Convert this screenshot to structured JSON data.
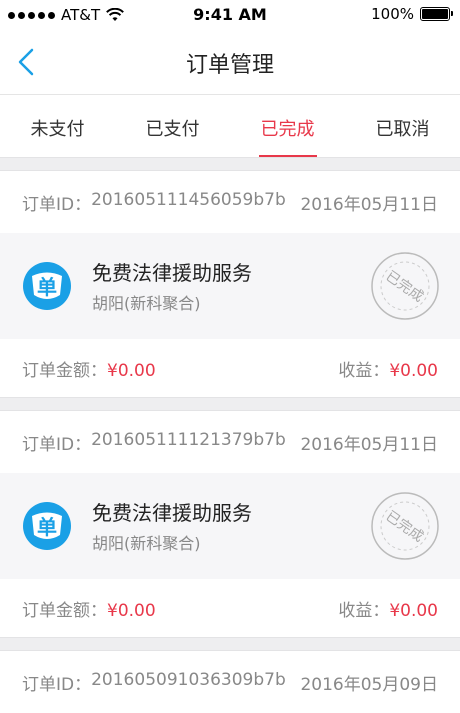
{
  "status_bar": {
    "carrier": "AT&T",
    "time": "9:41 AM",
    "battery": "100%",
    "battery_level": 1.0
  },
  "nav": {
    "title": "订单管理"
  },
  "tabs": [
    {
      "label": "未支付",
      "active": false
    },
    {
      "label": "已支付",
      "active": false
    },
    {
      "label": "已完成",
      "active": true
    },
    {
      "label": "已取消",
      "active": false
    }
  ],
  "orders": [
    {
      "id_label": "订单ID：",
      "id": "201605111456059b7b",
      "date": "2016年05月11日",
      "service": "免费法律援助服务",
      "provider": "胡阳(新科聚合)",
      "logo_char": "单",
      "stamp_text": "已完成",
      "amount_label": "订单金额：",
      "amount": "¥0.00",
      "income_label": "收益：",
      "income": "¥0.00"
    },
    {
      "id_label": "订单ID：",
      "id": "201605111121379b7b",
      "date": "2016年05月11日",
      "service": "免费法律援助服务",
      "provider": "胡阳(新科聚合)",
      "logo_char": "单",
      "stamp_text": "已完成",
      "amount_label": "订单金额：",
      "amount": "¥0.00",
      "income_label": "收益：",
      "income": "¥0.00"
    },
    {
      "id_label": "订单ID：",
      "id": "201605091036309b7b",
      "date": "2016年05月09日"
    }
  ],
  "colors": {
    "accent": "#e8384a",
    "logo_blue": "#1aa0e6"
  }
}
